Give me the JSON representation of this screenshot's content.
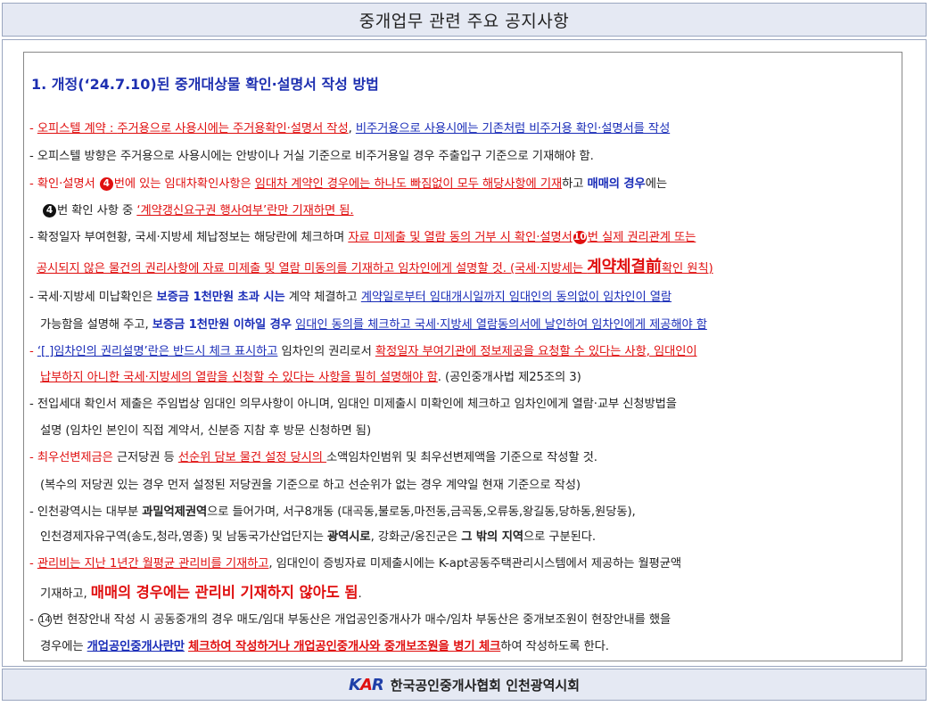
{
  "header": {
    "title": "중개업무 관련 주요 공지사항"
  },
  "section": {
    "title": "1.  개정(‘24.7.10)된 중개대상물 확인·설명서 작성 방법"
  },
  "lines": {
    "l1": {
      "dash": "- ",
      "a": "오피스텔 계약",
      "b": " : ",
      "c": "주거용으로 사용시에는 주거용확인·설명서 작성",
      "d": ", ",
      "e": "비주거용으로 사용시에는 기존처럼 비주거용 확인·설명서를 작성"
    },
    "l2": {
      "text": "- 오피스텔 방향은 주거용으로 사용시에는 안방이나 거실 기준으로 비주거용일 경우 주출입구 기준으로 기재해야 함."
    },
    "l3": {
      "a": "-   확인·설명서 ",
      "num": "4",
      "b": "번에 있는 임대차확인사항은 ",
      "c": "임대차 계약인 경우에는 하나도 빠짐없이 모두 해당사항에 기재",
      "d": "하고 ",
      "e": "매매의 경우",
      "f": "에는"
    },
    "l4": {
      "num": "4",
      "a": "번 확인 사항 중 ",
      "b": "‘계약갱신요구권 행사여부’란만 기재하면 됨."
    },
    "l5": {
      "a": "- 확정일자 부여현황, 국세·지방세 체납정보는 해당란에 체크하며 ",
      "b": "자료 미제출 및 열람 동의 거부 시 확인·설명서",
      "num": "10",
      "c": "번 실제 권리관계 또는"
    },
    "l6": {
      "a": "공시되지 않은 물건의 권리사항에 자료 미제출 및 열람 미동의를 기재하고 임차인에게 설명할 것. (국세·지방세는 ",
      "b": "계약체결前",
      "c": "확인 원칙)"
    },
    "l7": {
      "a": "- 국세·지방세 미납확인은 ",
      "b": "보증금 1천만원 초과 시는",
      "c": " 계약 체결하고 ",
      "d": "계약일로부터 임대개시일까지 임대인의 동의없이 임차인이 열람"
    },
    "l8": {
      "a": "가능함을 설명해 주고, ",
      "b": "보증금 1천만원 이하일 경우",
      "c": " ",
      "d": "임대인 동의를 체크하고 국세·지방세 열람동의서에 날인하여 임차인에게 제공해야 함"
    },
    "l9": {
      "a": "- ",
      "b": "‘[ ]임차인의 권리설명’란은 반드시 체크 표시하고",
      "c": " 임차인의 권리로서 ",
      "d": "확정일자 부여기관에 정보제공을 요청할 수 있다는 사항, 임대인이"
    },
    "l10": {
      "a": "납부하지 아니한 국세·지방세의 열람을 신청할 수 있다는 사항을 필히 설명해야 함",
      "b": ". (공인중개사법 제25조의 3)"
    },
    "l11": {
      "text": "- 전입세대 확인서 제출은 주임법상 임대인 의무사항이 아니며, 임대인 미제출시 미확인에 체크하고 임차인에게 열람·교부 신청방법을"
    },
    "l12": {
      "text": "설명 (임차인 본인이 직접 계약서, 신분증 지참 후 방문 신청하면 됨)"
    },
    "l13": {
      "a": "- 최우선변제금은",
      "b": "  근저당권 등 ",
      "c": "선순위 담보 물건 설정 당시의 ",
      "d": "소액임차인범위 및 최우선변제액을 기준으로 작성할 것."
    },
    "l14": {
      "text": "(복수의 저당권 있는 경우 먼저 설정된 저당권을 기준으로 하고 선순위가 없는 경우 계약일 현재 기준으로 작성)"
    },
    "l15": {
      "a": "- 인천광역시는 대부분 ",
      "b": "과밀억제권역",
      "c": "으로 들어가며, 서구8개동 (대곡동,불로동,마전동,금곡동,오류동,왕길동,당하동,원당동),"
    },
    "l16": {
      "a": "인천경제자유구역(송도,청라,영종)  및 남동국가산업단지는  ",
      "b": "광역시로",
      "c": ", 강화군/옹진군은  ",
      "d": "그 밖의 지역",
      "e": "으로 구분된다."
    },
    "l17": {
      "a": "- ",
      "b": "관리비는 지난 1년간 월평균 관리비를 기재하고",
      "c": ", 임대인이 증빙자료 미제출시에는 K-apt공동주택관리시스템에서  제공하는 월평균액"
    },
    "l18": {
      "a": "기재하고, ",
      "b": "매매의 경우에는 관리비 기재하지 않아도 됨",
      "c": "."
    },
    "l19": {
      "a": "- ",
      "num": "14",
      "b": "번 현장안내 작성 시 공동중개의 경우 매도/임대 부동산은 개업공인중개사가 매수/임차 부동산은 중개보조원이 현장안내를 했을"
    },
    "l20": {
      "a": "경우에는 ",
      "b": "개업공인중개사란만",
      "c": "  ",
      "d": "체크하여 작성하거나 개업공인중개사와 중개보조원을 병기 체크",
      "e": "하여 작성하도록 한다."
    }
  },
  "footer": {
    "logo_k": "K",
    "logo_a": "A",
    "logo_r": "R",
    "text": "한국공인중개사협회 인천광역시회"
  }
}
